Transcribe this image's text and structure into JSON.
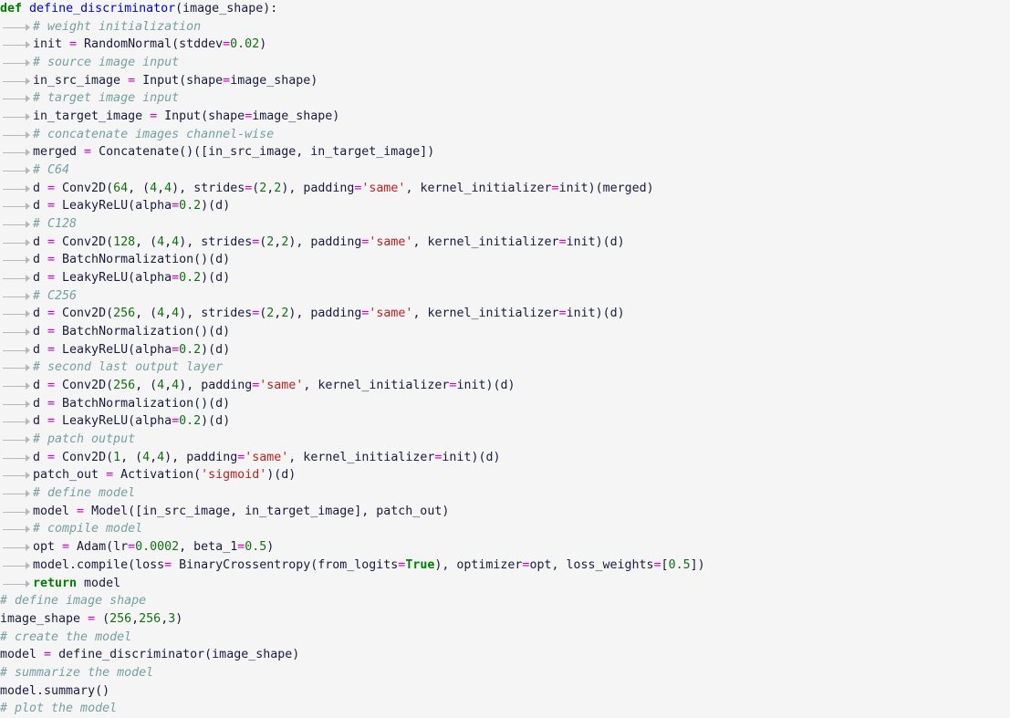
{
  "document": {
    "kind": "python-code-listing",
    "background_color": "#f5f5f5",
    "font_size_px": 13.3,
    "line_height_px": 19.68,
    "indent_marker": "tab-arrow-guide",
    "total_lines": 39,
    "colors": {
      "keyword": "#007f00",
      "function_name": "#0000d0",
      "identifier": "#1a1a40",
      "number": "#107010",
      "operator": "#cc00cc",
      "string": "#ba2121",
      "comment": "#75a0a0",
      "indent_guide": "#b8b8b8"
    }
  },
  "lines": [
    {
      "n": 1,
      "indent": 0,
      "text": "def define_discriminator(image_shape):",
      "tokens": [
        {
          "t": "def",
          "c": "kw"
        },
        {
          "t": " ",
          "c": "id"
        },
        {
          "t": "define_discriminator",
          "c": "fn"
        },
        {
          "t": "(image_shape):",
          "c": "id"
        }
      ]
    },
    {
      "n": 2,
      "indent": 1,
      "text": "# weight initialization",
      "tokens": [
        {
          "t": "# weight initialization",
          "c": "cmt"
        }
      ]
    },
    {
      "n": 3,
      "indent": 1,
      "text": "init = RandomNormal(stddev=0.02)",
      "tokens": [
        {
          "t": "init ",
          "c": "id"
        },
        {
          "t": "=",
          "c": "op"
        },
        {
          "t": " RandomNormal(stddev",
          "c": "id"
        },
        {
          "t": "=",
          "c": "op"
        },
        {
          "t": "0.02",
          "c": "num"
        },
        {
          "t": ")",
          "c": "id"
        }
      ]
    },
    {
      "n": 4,
      "indent": 1,
      "text": "# source image input",
      "tokens": [
        {
          "t": "# source image input",
          "c": "cmt"
        }
      ]
    },
    {
      "n": 5,
      "indent": 1,
      "text": "in_src_image = Input(shape=image_shape)",
      "tokens": [
        {
          "t": "in_src_image ",
          "c": "id"
        },
        {
          "t": "=",
          "c": "op"
        },
        {
          "t": " Input(shape",
          "c": "id"
        },
        {
          "t": "=",
          "c": "op"
        },
        {
          "t": "image_shape)",
          "c": "id"
        }
      ]
    },
    {
      "n": 6,
      "indent": 1,
      "text": "# target image input",
      "tokens": [
        {
          "t": "# target image input",
          "c": "cmt"
        }
      ]
    },
    {
      "n": 7,
      "indent": 1,
      "text": "in_target_image = Input(shape=image_shape)",
      "tokens": [
        {
          "t": "in_target_image ",
          "c": "id"
        },
        {
          "t": "=",
          "c": "op"
        },
        {
          "t": " Input(shape",
          "c": "id"
        },
        {
          "t": "=",
          "c": "op"
        },
        {
          "t": "image_shape)",
          "c": "id"
        }
      ]
    },
    {
      "n": 8,
      "indent": 1,
      "text": "# concatenate images channel-wise",
      "tokens": [
        {
          "t": "# concatenate images channel-wise",
          "c": "cmt"
        }
      ]
    },
    {
      "n": 9,
      "indent": 1,
      "text": "merged = Concatenate()([in_src_image, in_target_image])",
      "tokens": [
        {
          "t": "merged ",
          "c": "id"
        },
        {
          "t": "=",
          "c": "op"
        },
        {
          "t": " Concatenate()([in_src_image, in_target_image])",
          "c": "id"
        }
      ]
    },
    {
      "n": 10,
      "indent": 1,
      "text": "# C64",
      "tokens": [
        {
          "t": "# C64",
          "c": "cmt"
        }
      ]
    },
    {
      "n": 11,
      "indent": 1,
      "text": "d = Conv2D(64, (4,4), strides=(2,2), padding='same', kernel_initializer=init)(merged)",
      "tokens": [
        {
          "t": "d ",
          "c": "id"
        },
        {
          "t": "=",
          "c": "op"
        },
        {
          "t": " Conv2D(",
          "c": "id"
        },
        {
          "t": "64",
          "c": "num"
        },
        {
          "t": ", (",
          "c": "id"
        },
        {
          "t": "4",
          "c": "num"
        },
        {
          "t": ",",
          "c": "id"
        },
        {
          "t": "4",
          "c": "num"
        },
        {
          "t": "), strides",
          "c": "id"
        },
        {
          "t": "=",
          "c": "op"
        },
        {
          "t": "(",
          "c": "id"
        },
        {
          "t": "2",
          "c": "num"
        },
        {
          "t": ",",
          "c": "id"
        },
        {
          "t": "2",
          "c": "num"
        },
        {
          "t": "), padding",
          "c": "id"
        },
        {
          "t": "=",
          "c": "op"
        },
        {
          "t": "'same'",
          "c": "str"
        },
        {
          "t": ", kernel_initializer",
          "c": "id"
        },
        {
          "t": "=",
          "c": "op"
        },
        {
          "t": "init)(merged)",
          "c": "id"
        }
      ]
    },
    {
      "n": 12,
      "indent": 1,
      "text": "d = LeakyReLU(alpha=0.2)(d)",
      "tokens": [
        {
          "t": "d ",
          "c": "id"
        },
        {
          "t": "=",
          "c": "op"
        },
        {
          "t": " LeakyReLU(alpha",
          "c": "id"
        },
        {
          "t": "=",
          "c": "op"
        },
        {
          "t": "0.2",
          "c": "num"
        },
        {
          "t": ")(d)",
          "c": "id"
        }
      ]
    },
    {
      "n": 13,
      "indent": 1,
      "text": "# C128",
      "tokens": [
        {
          "t": "# C128",
          "c": "cmt"
        }
      ]
    },
    {
      "n": 14,
      "indent": 1,
      "text": "d = Conv2D(128, (4,4), strides=(2,2), padding='same', kernel_initializer=init)(d)",
      "tokens": [
        {
          "t": "d ",
          "c": "id"
        },
        {
          "t": "=",
          "c": "op"
        },
        {
          "t": " Conv2D(",
          "c": "id"
        },
        {
          "t": "128",
          "c": "num"
        },
        {
          "t": ", (",
          "c": "id"
        },
        {
          "t": "4",
          "c": "num"
        },
        {
          "t": ",",
          "c": "id"
        },
        {
          "t": "4",
          "c": "num"
        },
        {
          "t": "), strides",
          "c": "id"
        },
        {
          "t": "=",
          "c": "op"
        },
        {
          "t": "(",
          "c": "id"
        },
        {
          "t": "2",
          "c": "num"
        },
        {
          "t": ",",
          "c": "id"
        },
        {
          "t": "2",
          "c": "num"
        },
        {
          "t": "), padding",
          "c": "id"
        },
        {
          "t": "=",
          "c": "op"
        },
        {
          "t": "'same'",
          "c": "str"
        },
        {
          "t": ", kernel_initializer",
          "c": "id"
        },
        {
          "t": "=",
          "c": "op"
        },
        {
          "t": "init)(d)",
          "c": "id"
        }
      ]
    },
    {
      "n": 15,
      "indent": 1,
      "text": "d = BatchNormalization()(d)",
      "tokens": [
        {
          "t": "d ",
          "c": "id"
        },
        {
          "t": "=",
          "c": "op"
        },
        {
          "t": " BatchNormalization()(d)",
          "c": "id"
        }
      ]
    },
    {
      "n": 16,
      "indent": 1,
      "text": "d = LeakyReLU(alpha=0.2)(d)",
      "tokens": [
        {
          "t": "d ",
          "c": "id"
        },
        {
          "t": "=",
          "c": "op"
        },
        {
          "t": " LeakyReLU(alpha",
          "c": "id"
        },
        {
          "t": "=",
          "c": "op"
        },
        {
          "t": "0.2",
          "c": "num"
        },
        {
          "t": ")(d)",
          "c": "id"
        }
      ]
    },
    {
      "n": 17,
      "indent": 1,
      "text": "# C256",
      "tokens": [
        {
          "t": "# C256",
          "c": "cmt"
        }
      ]
    },
    {
      "n": 18,
      "indent": 1,
      "text": "d = Conv2D(256, (4,4), strides=(2,2), padding='same', kernel_initializer=init)(d)",
      "tokens": [
        {
          "t": "d ",
          "c": "id"
        },
        {
          "t": "=",
          "c": "op"
        },
        {
          "t": " Conv2D(",
          "c": "id"
        },
        {
          "t": "256",
          "c": "num"
        },
        {
          "t": ", (",
          "c": "id"
        },
        {
          "t": "4",
          "c": "num"
        },
        {
          "t": ",",
          "c": "id"
        },
        {
          "t": "4",
          "c": "num"
        },
        {
          "t": "), strides",
          "c": "id"
        },
        {
          "t": "=",
          "c": "op"
        },
        {
          "t": "(",
          "c": "id"
        },
        {
          "t": "2",
          "c": "num"
        },
        {
          "t": ",",
          "c": "id"
        },
        {
          "t": "2",
          "c": "num"
        },
        {
          "t": "), padding",
          "c": "id"
        },
        {
          "t": "=",
          "c": "op"
        },
        {
          "t": "'same'",
          "c": "str"
        },
        {
          "t": ", kernel_initializer",
          "c": "id"
        },
        {
          "t": "=",
          "c": "op"
        },
        {
          "t": "init)(d)",
          "c": "id"
        }
      ]
    },
    {
      "n": 19,
      "indent": 1,
      "text": "d = BatchNormalization()(d)",
      "tokens": [
        {
          "t": "d ",
          "c": "id"
        },
        {
          "t": "=",
          "c": "op"
        },
        {
          "t": " BatchNormalization()(d)",
          "c": "id"
        }
      ]
    },
    {
      "n": 20,
      "indent": 1,
      "text": "d = LeakyReLU(alpha=0.2)(d)",
      "tokens": [
        {
          "t": "d ",
          "c": "id"
        },
        {
          "t": "=",
          "c": "op"
        },
        {
          "t": " LeakyReLU(alpha",
          "c": "id"
        },
        {
          "t": "=",
          "c": "op"
        },
        {
          "t": "0.2",
          "c": "num"
        },
        {
          "t": ")(d)",
          "c": "id"
        }
      ]
    },
    {
      "n": 21,
      "indent": 1,
      "text": "# second last output layer",
      "tokens": [
        {
          "t": "# second last output layer",
          "c": "cmt"
        }
      ]
    },
    {
      "n": 22,
      "indent": 1,
      "text": "d = Conv2D(256, (4,4), padding='same', kernel_initializer=init)(d)",
      "tokens": [
        {
          "t": "d ",
          "c": "id"
        },
        {
          "t": "=",
          "c": "op"
        },
        {
          "t": " Conv2D(",
          "c": "id"
        },
        {
          "t": "256",
          "c": "num"
        },
        {
          "t": ", (",
          "c": "id"
        },
        {
          "t": "4",
          "c": "num"
        },
        {
          "t": ",",
          "c": "id"
        },
        {
          "t": "4",
          "c": "num"
        },
        {
          "t": "), padding",
          "c": "id"
        },
        {
          "t": "=",
          "c": "op"
        },
        {
          "t": "'same'",
          "c": "str"
        },
        {
          "t": ", kernel_initializer",
          "c": "id"
        },
        {
          "t": "=",
          "c": "op"
        },
        {
          "t": "init)(d)",
          "c": "id"
        }
      ]
    },
    {
      "n": 23,
      "indent": 1,
      "text": "d = BatchNormalization()(d)",
      "tokens": [
        {
          "t": "d ",
          "c": "id"
        },
        {
          "t": "=",
          "c": "op"
        },
        {
          "t": " BatchNormalization()(d)",
          "c": "id"
        }
      ]
    },
    {
      "n": 24,
      "indent": 1,
      "text": "d = LeakyReLU(alpha=0.2)(d)",
      "tokens": [
        {
          "t": "d ",
          "c": "id"
        },
        {
          "t": "=",
          "c": "op"
        },
        {
          "t": " LeakyReLU(alpha",
          "c": "id"
        },
        {
          "t": "=",
          "c": "op"
        },
        {
          "t": "0.2",
          "c": "num"
        },
        {
          "t": ")(d)",
          "c": "id"
        }
      ]
    },
    {
      "n": 25,
      "indent": 1,
      "text": "# patch output",
      "tokens": [
        {
          "t": "# patch output",
          "c": "cmt"
        }
      ]
    },
    {
      "n": 26,
      "indent": 1,
      "text": "d = Conv2D(1, (4,4), padding='same', kernel_initializer=init)(d)",
      "tokens": [
        {
          "t": "d ",
          "c": "id"
        },
        {
          "t": "=",
          "c": "op"
        },
        {
          "t": " Conv2D(",
          "c": "id"
        },
        {
          "t": "1",
          "c": "num"
        },
        {
          "t": ", (",
          "c": "id"
        },
        {
          "t": "4",
          "c": "num"
        },
        {
          "t": ",",
          "c": "id"
        },
        {
          "t": "4",
          "c": "num"
        },
        {
          "t": "), padding",
          "c": "id"
        },
        {
          "t": "=",
          "c": "op"
        },
        {
          "t": "'same'",
          "c": "str"
        },
        {
          "t": ", kernel_initializer",
          "c": "id"
        },
        {
          "t": "=",
          "c": "op"
        },
        {
          "t": "init)(d)",
          "c": "id"
        }
      ]
    },
    {
      "n": 27,
      "indent": 1,
      "text": "patch_out = Activation('sigmoid')(d)",
      "tokens": [
        {
          "t": "patch_out ",
          "c": "id"
        },
        {
          "t": "=",
          "c": "op"
        },
        {
          "t": " Activation(",
          "c": "id"
        },
        {
          "t": "'sigmoid'",
          "c": "str"
        },
        {
          "t": ")(d)",
          "c": "id"
        }
      ]
    },
    {
      "n": 28,
      "indent": 1,
      "text": "# define model",
      "tokens": [
        {
          "t": "# define model",
          "c": "cmt"
        }
      ]
    },
    {
      "n": 29,
      "indent": 1,
      "text": "model = Model([in_src_image, in_target_image], patch_out)",
      "tokens": [
        {
          "t": "model ",
          "c": "id"
        },
        {
          "t": "=",
          "c": "op"
        },
        {
          "t": " Model([in_src_image, in_target_image], patch_out)",
          "c": "id"
        }
      ]
    },
    {
      "n": 30,
      "indent": 1,
      "text": "# compile model",
      "tokens": [
        {
          "t": "# compile model",
          "c": "cmt"
        }
      ]
    },
    {
      "n": 31,
      "indent": 1,
      "text": "opt = Adam(lr=0.0002, beta_1=0.5)",
      "tokens": [
        {
          "t": "opt ",
          "c": "id"
        },
        {
          "t": "=",
          "c": "op"
        },
        {
          "t": " Adam(lr",
          "c": "id"
        },
        {
          "t": "=",
          "c": "op"
        },
        {
          "t": "0.0002",
          "c": "num"
        },
        {
          "t": ", beta_1",
          "c": "id"
        },
        {
          "t": "=",
          "c": "op"
        },
        {
          "t": "0.5",
          "c": "num"
        },
        {
          "t": ")",
          "c": "id"
        }
      ]
    },
    {
      "n": 32,
      "indent": 1,
      "text": "model.compile(loss= BinaryCrossentropy(from_logits=True), optimizer=opt, loss_weights=[0.5])",
      "tokens": [
        {
          "t": "model.compile(loss",
          "c": "id"
        },
        {
          "t": "=",
          "c": "op"
        },
        {
          "t": " BinaryCrossentropy(from_logits",
          "c": "id"
        },
        {
          "t": "=",
          "c": "op"
        },
        {
          "t": "True",
          "c": "kw"
        },
        {
          "t": "), optimizer",
          "c": "id"
        },
        {
          "t": "=",
          "c": "op"
        },
        {
          "t": "opt, loss_weights",
          "c": "id"
        },
        {
          "t": "=",
          "c": "op"
        },
        {
          "t": "[",
          "c": "id"
        },
        {
          "t": "0.5",
          "c": "num"
        },
        {
          "t": "])",
          "c": "id"
        }
      ]
    },
    {
      "n": 33,
      "indent": 1,
      "text": "return model",
      "tokens": [
        {
          "t": "return",
          "c": "kw"
        },
        {
          "t": " model",
          "c": "id"
        }
      ]
    },
    {
      "n": 34,
      "indent": 0,
      "text": "# define image shape",
      "tokens": [
        {
          "t": "# define image shape",
          "c": "cmt"
        }
      ]
    },
    {
      "n": 35,
      "indent": 0,
      "text": "image_shape = (256,256,3)",
      "tokens": [
        {
          "t": "image_shape ",
          "c": "id"
        },
        {
          "t": "=",
          "c": "op"
        },
        {
          "t": " (",
          "c": "id"
        },
        {
          "t": "256",
          "c": "num"
        },
        {
          "t": ",",
          "c": "id"
        },
        {
          "t": "256",
          "c": "num"
        },
        {
          "t": ",",
          "c": "id"
        },
        {
          "t": "3",
          "c": "num"
        },
        {
          "t": ")",
          "c": "id"
        }
      ]
    },
    {
      "n": 36,
      "indent": 0,
      "text": "# create the model",
      "tokens": [
        {
          "t": "# create the model",
          "c": "cmt"
        }
      ]
    },
    {
      "n": 37,
      "indent": 0,
      "text": "model = define_discriminator(image_shape)",
      "tokens": [
        {
          "t": "model ",
          "c": "id"
        },
        {
          "t": "=",
          "c": "op"
        },
        {
          "t": " define_discriminator(image_shape)",
          "c": "id"
        }
      ]
    },
    {
      "n": 38,
      "indent": 0,
      "text": "# summarize the model",
      "tokens": [
        {
          "t": "# summarize the model",
          "c": "cmt"
        }
      ]
    },
    {
      "n": 39,
      "indent": 0,
      "text": "model.summary()",
      "tokens": [
        {
          "t": "model.summary()",
          "c": "id"
        }
      ]
    },
    {
      "n": 40,
      "indent": 0,
      "text": "# plot the model",
      "tokens": [
        {
          "t": "# plot the model",
          "c": "cmt"
        }
      ]
    }
  ]
}
